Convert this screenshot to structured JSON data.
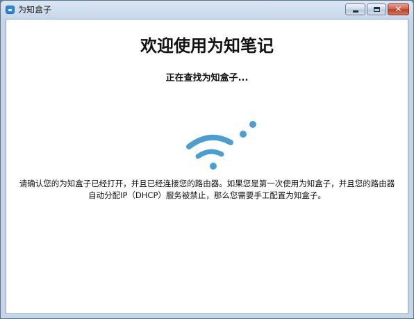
{
  "window": {
    "title": "为知盒子",
    "icon": "app-icon",
    "controls": {
      "minimize": "minimize-icon",
      "maximize": "maximize-icon",
      "close": "close-icon",
      "close_glyph": "✕"
    }
  },
  "main": {
    "heading": "欢迎使用为知笔记",
    "status": "正在查找为知盒子...",
    "status_icon": "wifi-searching-icon",
    "instructions_line1": "请确认您的为知盒子已经打开，并且已经连接您的路由器。如果您是第一次使用为知盒子，并且您的路由器",
    "instructions_line2": "自动分配IP（DHCP）服务被禁止，那么您需要手工配置为知盒子。"
  },
  "colors": {
    "accent": "#4a9fd0",
    "title_bar": "#c5d6ea",
    "close_button": "#c7492f"
  }
}
